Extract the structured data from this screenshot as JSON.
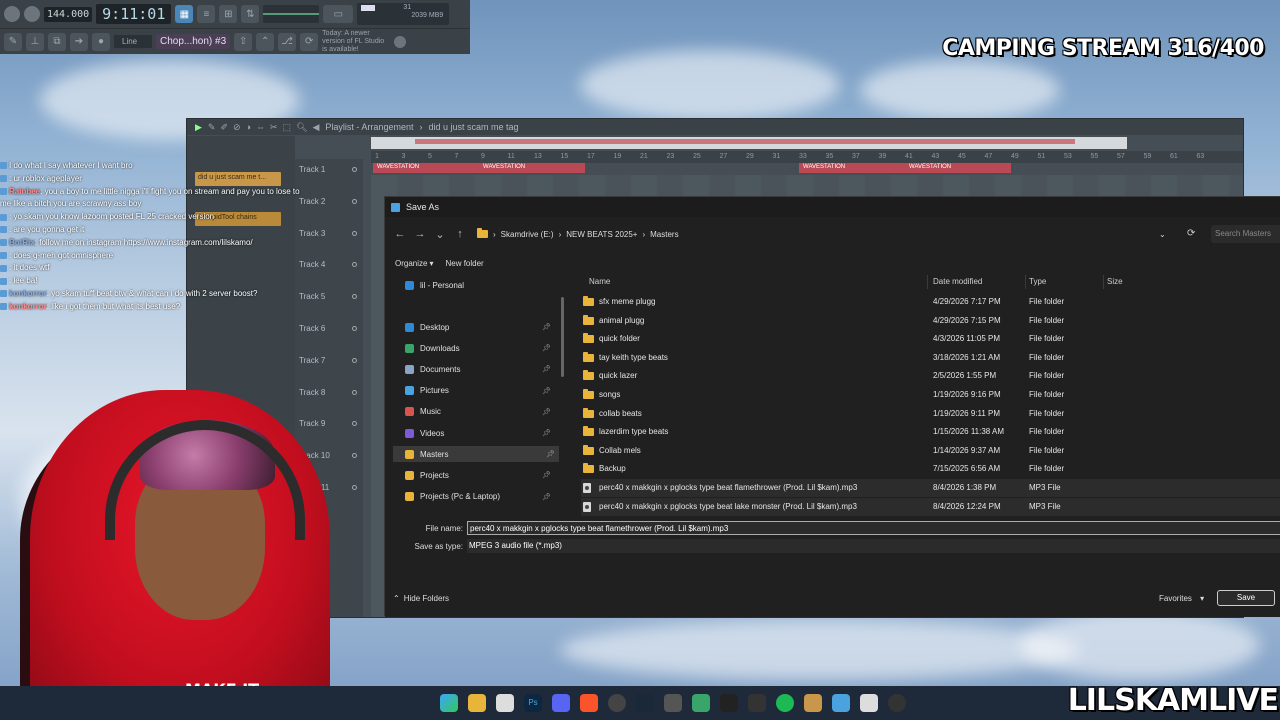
{
  "fl_studio": {
    "tempo": "144.000",
    "time": "9:11:01",
    "cpu_value": "31",
    "mem_value": "2039 MB",
    "voices": "9",
    "snap": "Line",
    "pattern": "Chop...hon) #3",
    "update_hint": "Today: A newer version of FL Studio is available!"
  },
  "overlay": {
    "stream_title": "CAMPING STREAM 316/400",
    "brand": "LILSKAMLIVE"
  },
  "playlist": {
    "title": "Playlist - Arrangement",
    "pattern_name": "did u just scam me tag",
    "left_clips": [
      "did u just scam me t...",
      "StoopidTool chains"
    ],
    "tracks": [
      "Track 1",
      "Track 2",
      "Track 3",
      "Track 4",
      "Track 5",
      "Track 6",
      "Track 7",
      "Track 8",
      "Track 9",
      "Track 10",
      "Track 11"
    ],
    "ruler": [
      "1",
      "3",
      "5",
      "7",
      "9",
      "11",
      "13",
      "15",
      "17",
      "19",
      "21",
      "23",
      "25",
      "27",
      "29",
      "31",
      "33",
      "35",
      "37",
      "39",
      "41",
      "43",
      "45",
      "47",
      "49",
      "51",
      "53",
      "55",
      "57",
      "59",
      "61",
      "63"
    ],
    "clip_label": "WAVESTATION"
  },
  "chat": [
    {
      "name": "",
      "text": "I do what I say whatever I want bro"
    },
    {
      "name": "",
      "text": ": ur roblox ageplayer"
    },
    {
      "name": "Rainbee",
      "text": ": you a boy to me little nigga i'll fight you on stream and pay you to lose to me like a bitch you are scrawny ass boy"
    },
    {
      "name": "",
      "text": ": yo skam you know lazoom posted FL 25 cracked version"
    },
    {
      "name": "",
      "text": ": are you gonna get it"
    },
    {
      "name": "BotRix",
      "text": ": follow me on instagram https://www.instagram.com/lilskamo/"
    },
    {
      "name": "",
      "text": ": does g-meh got omnisphere"
    },
    {
      "name": "",
      "text": ": it does wtf"
    },
    {
      "name": "",
      "text": ": lee ba!"
    },
    {
      "name": "konkorror",
      "text": ": yo skam tuff beat btw & what can i do with 2 server boost?"
    },
    {
      "name": "konkorror",
      "text": ": like i got them but what its best use?"
    }
  ],
  "dialog": {
    "title": "Save As",
    "breadcrumb": [
      "Skamdrive (E:)",
      "NEW BEATS 2025+",
      "Masters"
    ],
    "search_placeholder": "Search Masters",
    "organize": "Organize",
    "new_folder": "New folder",
    "columns": {
      "name": "Name",
      "date": "Date modified",
      "type": "Type",
      "size": "Size"
    },
    "nav": [
      {
        "label": "lil - Personal",
        "color": "#2e8ad8"
      },
      {
        "label": "Desktop",
        "color": "#2e8ad8"
      },
      {
        "label": "Downloads",
        "color": "#3aa56b"
      },
      {
        "label": "Documents",
        "color": "#8aa4c8"
      },
      {
        "label": "Pictures",
        "color": "#4aa3df"
      },
      {
        "label": "Music",
        "color": "#d9534f"
      },
      {
        "label": "Videos",
        "color": "#7b5bd6"
      },
      {
        "label": "Masters",
        "color": "#e8b53a"
      },
      {
        "label": "Projects",
        "color": "#e8b53a"
      },
      {
        "label": "Projects (Pc & Laptop)",
        "color": "#e8b53a"
      }
    ],
    "files": [
      {
        "name": "sfx meme plugg",
        "date": "4/29/2026 7:17 PM",
        "type": "File folder",
        "icon": "folder"
      },
      {
        "name": "animal plugg",
        "date": "4/29/2026 7:15 PM",
        "type": "File folder",
        "icon": "folder"
      },
      {
        "name": "quick folder",
        "date": "4/3/2026 11:05 PM",
        "type": "File folder",
        "icon": "folder"
      },
      {
        "name": "tay keith type beats",
        "date": "3/18/2026 1:21 AM",
        "type": "File folder",
        "icon": "folder"
      },
      {
        "name": "quick lazer",
        "date": "2/5/2026 1:55 PM",
        "type": "File folder",
        "icon": "folder"
      },
      {
        "name": "songs",
        "date": "1/19/2026 9:16 PM",
        "type": "File folder",
        "icon": "folder"
      },
      {
        "name": "collab beats",
        "date": "1/19/2026 9:11 PM",
        "type": "File folder",
        "icon": "folder"
      },
      {
        "name": "lazerdim type beats",
        "date": "1/15/2026 11:38 AM",
        "type": "File folder",
        "icon": "folder"
      },
      {
        "name": "Collab mels",
        "date": "1/14/2026 9:37 AM",
        "type": "File folder",
        "icon": "folder"
      },
      {
        "name": "Backup",
        "date": "7/15/2025 6:56 AM",
        "type": "File folder",
        "icon": "folder"
      },
      {
        "name": "perc40 x makkgin x pglocks type beat flamethrower (Prod. Lil $kam).mp3",
        "date": "8/4/2026 1:38 PM",
        "type": "MP3 File",
        "icon": "mp3"
      },
      {
        "name": "perc40 x makkgin x pglocks type beat lake monster (Prod. Lil $kam).mp3",
        "date": "8/4/2026 12:24 PM",
        "type": "MP3 File",
        "icon": "mp3"
      }
    ],
    "file_name_label": "File name:",
    "file_name_value": "perc40 x makkgin x pglocks type beat flamethrower (Prod. Lil $kam).mp3",
    "save_type_label": "Save as type:",
    "save_type_value": "MPEG 3 audio file (*.mp3)",
    "hide_folders": "Hide Folders",
    "favorites": "Favorites",
    "save": "Save"
  },
  "streamer": {
    "shirt_text": "MAKE IT"
  },
  "colors": {
    "hoodie": "#d0101f",
    "wavestation_clip": "#b94a55",
    "folder": "#e8b53a"
  }
}
